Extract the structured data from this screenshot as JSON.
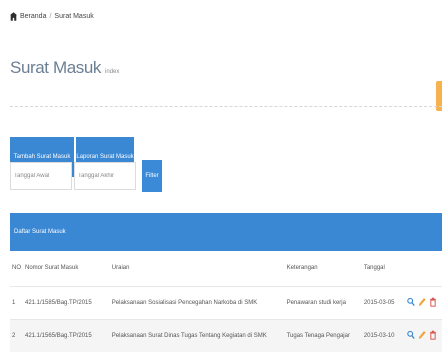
{
  "breadcrumb": {
    "home_icon": "home-icon",
    "home": "Beranda",
    "current": "Surat Masuk"
  },
  "page": {
    "title": "Surat Masuk",
    "subtitle": "index"
  },
  "tabs": [
    {
      "label": "Tambah Surat Masuk"
    },
    {
      "label": "Laporan Surat Masuk"
    }
  ],
  "filter": {
    "from_placeholder": "Tanggal Awal",
    "to_placeholder": "Tanggal Akhir",
    "button": "Filter"
  },
  "panel": {
    "title": "Daftar Surat Masuk"
  },
  "table": {
    "columns": [
      "NO",
      "Nomor Surat Masuk",
      "Uraian",
      "Keterangan",
      "Tanggal",
      ""
    ],
    "rows": [
      {
        "no": "1",
        "nomor": "421.1/1585/Bag.TP/2015",
        "uraian": "Pelaksanaan Sosialisasi Pencegahan Narkoba di SMK",
        "ket": "Penawaran studi kerja",
        "tgl": "2015-03-05"
      },
      {
        "no": "2",
        "nomor": "421.1/1565/Bag.TP/2015",
        "uraian": "Pelaksanaan Surat Dinas Tugas Tentang Kegiatan di SMK",
        "ket": "Tugas Tenaga Pengajar",
        "tgl": "2015-03-10"
      }
    ]
  },
  "icons": {
    "view": "magnifier-icon",
    "edit": "pencil-icon",
    "delete": "trash-icon"
  },
  "colors": {
    "accent": "#3a87d4",
    "side": "#f6b24c",
    "view": "#3a87d4",
    "edit": "#f0a43a",
    "delete": "#d9534f"
  }
}
